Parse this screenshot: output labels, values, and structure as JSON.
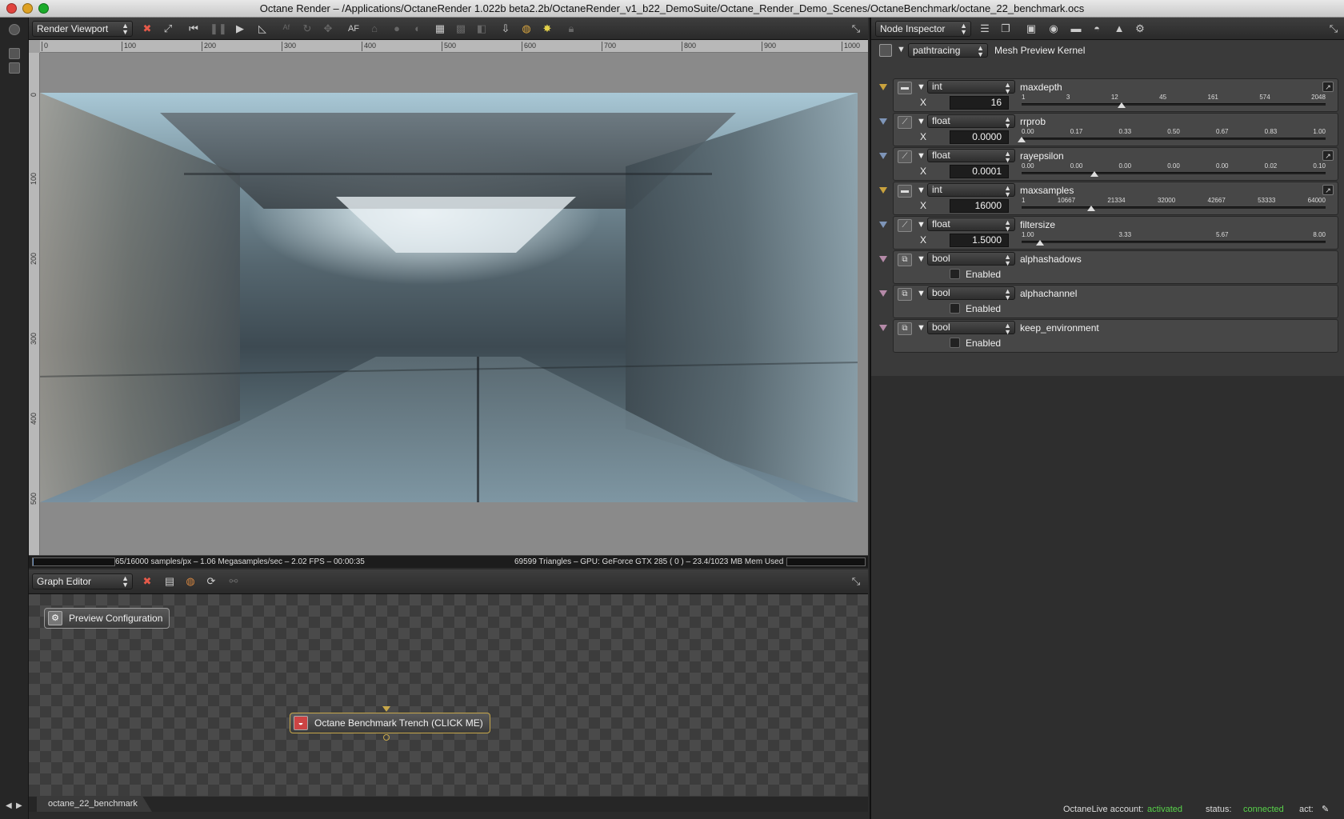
{
  "window": {
    "title": "Octane Render – /Applications/OctaneRender 1.022b beta2.2b/OctaneRender_v1_b22_DemoSuite/Octane_Render_Demo_Scenes/OctaneBenchmark/octane_22_benchmark.ocs"
  },
  "viewport": {
    "panel_label": "Render Viewport",
    "toolbar_af": "AF",
    "ruler_h": [
      "0",
      "100",
      "200",
      "300",
      "400",
      "500",
      "600",
      "700",
      "800",
      "900",
      "1000"
    ],
    "ruler_v": [
      "0",
      "100",
      "200",
      "300",
      "400",
      "500"
    ],
    "status_left": "65/16000 samples/px – 1.06 Megasamples/sec – 2.02 FPS – 00:00:35",
    "status_right": "69599 Triangles – GPU: GeForce GTX 285 ( 0 ) – 23.4/1023 MB Mem Used",
    "progress": 0.004
  },
  "graph_editor": {
    "panel_label": "Graph Editor",
    "nodes": {
      "preview_config": "Preview Configuration",
      "benchmark": "Octane Benchmark Trench (CLICK ME)"
    },
    "tab": "octane_22_benchmark"
  },
  "inspector": {
    "panel_label": "Node Inspector",
    "kernel_type": "pathtracing",
    "kernel_name": "Mesh Preview Kernel",
    "x_label": "X",
    "params": [
      {
        "type": "int",
        "name": "maxdepth",
        "value": "16",
        "ticks": [
          "1",
          "3",
          "12",
          "45",
          "161",
          "574",
          "2048"
        ],
        "thumb": 0.33
      },
      {
        "type": "float",
        "name": "rrprob",
        "value": "0.0000",
        "ticks": [
          "0.00",
          "0.17",
          "0.33",
          "0.50",
          "0.67",
          "0.83",
          "1.00"
        ],
        "thumb": 0.0
      },
      {
        "type": "float",
        "name": "rayepsilon",
        "value": "0.0001",
        "ticks": [
          "0.00",
          "0.00",
          "0.00",
          "0.00",
          "0.00",
          "0.02",
          "0.10"
        ],
        "thumb": 0.24
      },
      {
        "type": "int",
        "name": "maxsamples",
        "value": "16000",
        "ticks": [
          "1",
          "10667",
          "21334",
          "32000",
          "42667",
          "53333",
          "64000"
        ],
        "thumb": 0.23
      },
      {
        "type": "float",
        "name": "filtersize",
        "value": "1.5000",
        "ticks": [
          "1.00",
          "3.33",
          "5.67",
          "8.00"
        ],
        "thumb": 0.06
      }
    ],
    "bools": [
      {
        "type": "bool",
        "name": "alphashadows",
        "label": "Enabled"
      },
      {
        "type": "bool",
        "name": "alphachannel",
        "label": "Enabled"
      },
      {
        "type": "bool",
        "name": "keep_environment",
        "label": "Enabled"
      }
    ]
  },
  "footer": {
    "account_label": "OctaneLive account:",
    "account_value": "activated",
    "status_label": "status:",
    "status_value": "connected",
    "act_label": "act:"
  },
  "colors": {
    "green_status": "#58d24a",
    "pin_int": "#c9a23d",
    "pin_float": "#7e95b8",
    "pin_bool": "#b58aa8"
  }
}
